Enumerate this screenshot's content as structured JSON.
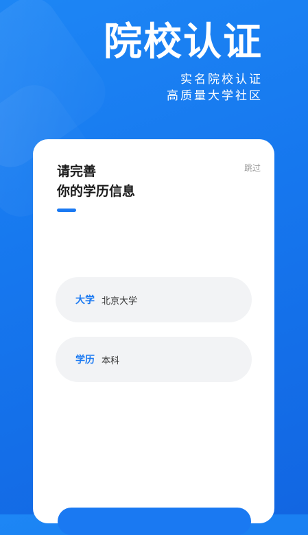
{
  "header": {
    "title": "院校认证",
    "subtitle_line1": "实名院校认证",
    "subtitle_line2": "高质量大学社区"
  },
  "card": {
    "skip_label": "跳过",
    "title_line1": "请完善",
    "title_line2": "你的学历信息",
    "fields": [
      {
        "label": "大学",
        "value": "北京大学"
      },
      {
        "label": "学历",
        "value": "本科"
      }
    ]
  },
  "colors": {
    "accent": "#1a79f2",
    "background": "#1677ee"
  }
}
